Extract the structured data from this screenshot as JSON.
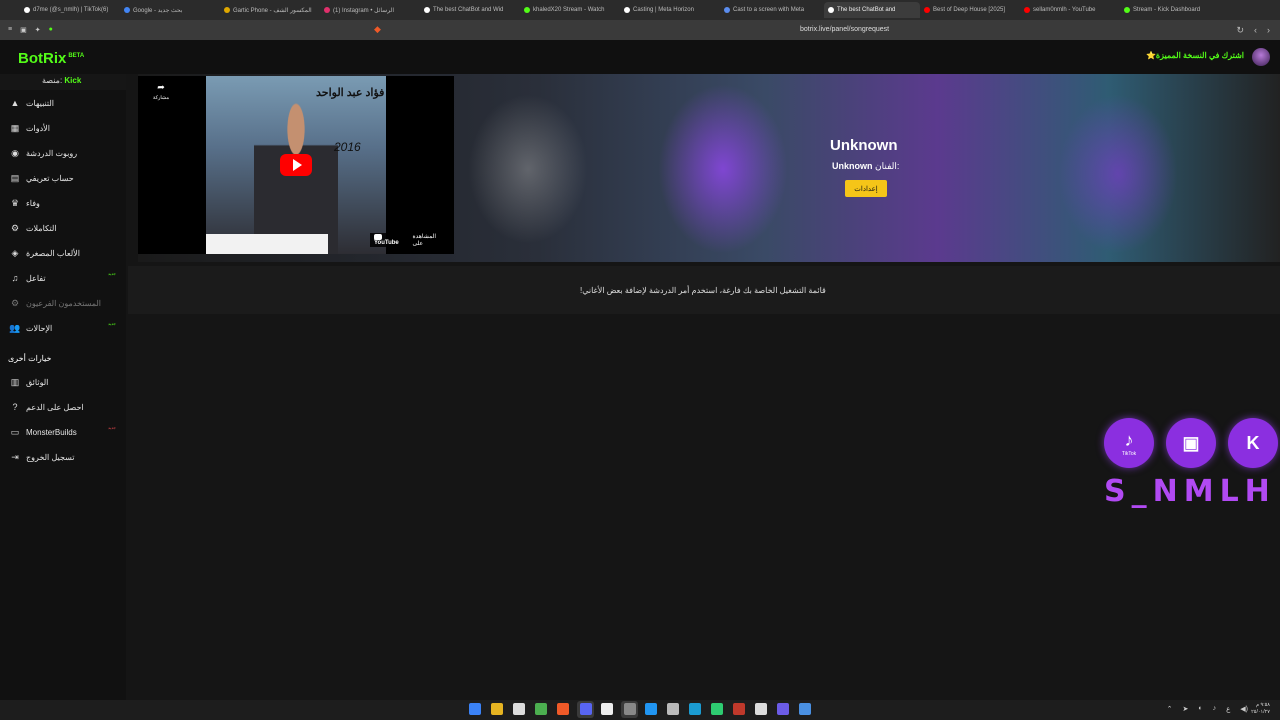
{
  "browser": {
    "tabs": [
      {
        "label": "d7me (@s_nmlh) | TikTok(6)",
        "color": "#ffffff"
      },
      {
        "label": "Google - بحث جديد",
        "color": "#4285f4"
      },
      {
        "label": "Gartic Phone - المكسور الشف",
        "color": "#e0a800"
      },
      {
        "label": "(1) Instagram • الرسائل",
        "color": "#e1306c"
      },
      {
        "label": "The best ChatBot and Wid",
        "color": "#ffffff"
      },
      {
        "label": "khaledX20 Stream - Watch",
        "color": "#53fc18"
      },
      {
        "label": "Casting | Meta Horizon",
        "color": "#ffffff"
      },
      {
        "label": "Cast to a screen with Meta",
        "color": "#5b8def"
      },
      {
        "label": "The best ChatBot and",
        "color": "#ffffff",
        "active": true
      },
      {
        "label": "Best of Deep House [2025]",
        "color": "#ff0000"
      },
      {
        "label": "sellam0nmlh - YouTube",
        "color": "#ff0000"
      },
      {
        "label": "Stream - Kick Dashboard",
        "color": "#53fc18"
      }
    ],
    "url": "botrix.live/panel/songrequest"
  },
  "header": {
    "logo": "BotRix",
    "logo_badge": "BETA",
    "platform_label": "منصة:",
    "platform_value": "Kick",
    "premium_link": "اشترك في النسخة المميزة⭐"
  },
  "sidebar": {
    "items": [
      {
        "label": "التنبيهات",
        "icon": "alert-triangle-icon",
        "glyph": "▲"
      },
      {
        "label": "الأدوات",
        "icon": "tools-icon",
        "glyph": "▦"
      },
      {
        "label": "روبوت الدردشة",
        "icon": "robot-icon",
        "glyph": "◉"
      },
      {
        "label": "حساب تعريفي",
        "icon": "id-card-icon",
        "glyph": "▤"
      },
      {
        "label": "وفاء",
        "icon": "trophy-icon",
        "glyph": "♛"
      },
      {
        "label": "التكاملات",
        "icon": "integrations-icon",
        "glyph": "⚙"
      },
      {
        "label": "الألعاب المصغرة",
        "icon": "gamepad-icon",
        "glyph": "◈"
      },
      {
        "label": "تفاعل",
        "icon": "music-icon",
        "glyph": "♫",
        "badge": "جديد"
      },
      {
        "label": "المستخدمون الفرعيون",
        "icon": "users-cog-icon",
        "glyph": "⚙",
        "dim": true
      },
      {
        "label": "الإحالات",
        "icon": "users-icon",
        "glyph": "👥",
        "badge": "جديد"
      }
    ],
    "other_options_header": "خيارات أخرى",
    "other_items": [
      {
        "label": "الوثائق",
        "icon": "book-icon",
        "glyph": "▥"
      },
      {
        "label": "احصل على الدعم",
        "icon": "question-icon",
        "glyph": "?"
      },
      {
        "label": "MonsterBuilds",
        "icon": "monitor-icon",
        "glyph": "▭",
        "badge": "جديد"
      },
      {
        "label": "تسجيل الخروج",
        "icon": "logout-icon",
        "glyph": "⇥"
      }
    ]
  },
  "player": {
    "share_label": "مشاركة",
    "watch_on": "المشاهدة على",
    "youtube_label": "YouTube",
    "thumb_title": "فؤاد عبد الواحد",
    "thumb_year": "2016"
  },
  "song": {
    "title": "Unknown",
    "artist_label": "الفنان:",
    "artist_value": "Unknown",
    "settings_button": "إعدادات"
  },
  "queue": {
    "empty_message": "قائمة التشغيل الخاصة بك فارغة، استخدم أمر الدردشة لإضافة بعض الأغاني!"
  },
  "overlay": {
    "handle": "S_NMLH",
    "socials": [
      {
        "name": "TikTok",
        "glyph": "♪"
      },
      {
        "name": "Twitch",
        "glyph": "▣"
      },
      {
        "name": "Kick",
        "glyph": "K"
      }
    ]
  },
  "taskbar": {
    "clock_time": "٩:٥٨ م",
    "clock_date": "٢٥/٠١/٢٧"
  },
  "colors": {
    "accent": "#53fc18",
    "settings_button": "#f5c518",
    "overlay_purple": "#8b2fe0"
  }
}
